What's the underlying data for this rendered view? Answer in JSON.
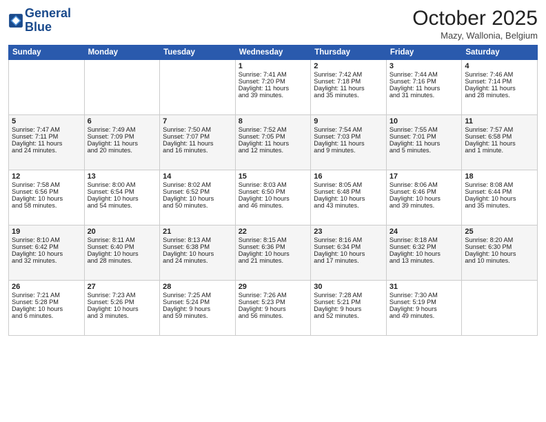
{
  "header": {
    "logo_line1": "General",
    "logo_line2": "Blue",
    "month": "October 2025",
    "location": "Mazy, Wallonia, Belgium"
  },
  "weekdays": [
    "Sunday",
    "Monday",
    "Tuesday",
    "Wednesday",
    "Thursday",
    "Friday",
    "Saturday"
  ],
  "weeks": [
    [
      {
        "day": "",
        "info": ""
      },
      {
        "day": "",
        "info": ""
      },
      {
        "day": "",
        "info": ""
      },
      {
        "day": "1",
        "info": "Sunrise: 7:41 AM\nSunset: 7:20 PM\nDaylight: 11 hours\nand 39 minutes."
      },
      {
        "day": "2",
        "info": "Sunrise: 7:42 AM\nSunset: 7:18 PM\nDaylight: 11 hours\nand 35 minutes."
      },
      {
        "day": "3",
        "info": "Sunrise: 7:44 AM\nSunset: 7:16 PM\nDaylight: 11 hours\nand 31 minutes."
      },
      {
        "day": "4",
        "info": "Sunrise: 7:46 AM\nSunset: 7:14 PM\nDaylight: 11 hours\nand 28 minutes."
      }
    ],
    [
      {
        "day": "5",
        "info": "Sunrise: 7:47 AM\nSunset: 7:11 PM\nDaylight: 11 hours\nand 24 minutes."
      },
      {
        "day": "6",
        "info": "Sunrise: 7:49 AM\nSunset: 7:09 PM\nDaylight: 11 hours\nand 20 minutes."
      },
      {
        "day": "7",
        "info": "Sunrise: 7:50 AM\nSunset: 7:07 PM\nDaylight: 11 hours\nand 16 minutes."
      },
      {
        "day": "8",
        "info": "Sunrise: 7:52 AM\nSunset: 7:05 PM\nDaylight: 11 hours\nand 12 minutes."
      },
      {
        "day": "9",
        "info": "Sunrise: 7:54 AM\nSunset: 7:03 PM\nDaylight: 11 hours\nand 9 minutes."
      },
      {
        "day": "10",
        "info": "Sunrise: 7:55 AM\nSunset: 7:01 PM\nDaylight: 11 hours\nand 5 minutes."
      },
      {
        "day": "11",
        "info": "Sunrise: 7:57 AM\nSunset: 6:58 PM\nDaylight: 11 hours\nand 1 minute."
      }
    ],
    [
      {
        "day": "12",
        "info": "Sunrise: 7:58 AM\nSunset: 6:56 PM\nDaylight: 10 hours\nand 58 minutes."
      },
      {
        "day": "13",
        "info": "Sunrise: 8:00 AM\nSunset: 6:54 PM\nDaylight: 10 hours\nand 54 minutes."
      },
      {
        "day": "14",
        "info": "Sunrise: 8:02 AM\nSunset: 6:52 PM\nDaylight: 10 hours\nand 50 minutes."
      },
      {
        "day": "15",
        "info": "Sunrise: 8:03 AM\nSunset: 6:50 PM\nDaylight: 10 hours\nand 46 minutes."
      },
      {
        "day": "16",
        "info": "Sunrise: 8:05 AM\nSunset: 6:48 PM\nDaylight: 10 hours\nand 43 minutes."
      },
      {
        "day": "17",
        "info": "Sunrise: 8:06 AM\nSunset: 6:46 PM\nDaylight: 10 hours\nand 39 minutes."
      },
      {
        "day": "18",
        "info": "Sunrise: 8:08 AM\nSunset: 6:44 PM\nDaylight: 10 hours\nand 35 minutes."
      }
    ],
    [
      {
        "day": "19",
        "info": "Sunrise: 8:10 AM\nSunset: 6:42 PM\nDaylight: 10 hours\nand 32 minutes."
      },
      {
        "day": "20",
        "info": "Sunrise: 8:11 AM\nSunset: 6:40 PM\nDaylight: 10 hours\nand 28 minutes."
      },
      {
        "day": "21",
        "info": "Sunrise: 8:13 AM\nSunset: 6:38 PM\nDaylight: 10 hours\nand 24 minutes."
      },
      {
        "day": "22",
        "info": "Sunrise: 8:15 AM\nSunset: 6:36 PM\nDaylight: 10 hours\nand 21 minutes."
      },
      {
        "day": "23",
        "info": "Sunrise: 8:16 AM\nSunset: 6:34 PM\nDaylight: 10 hours\nand 17 minutes."
      },
      {
        "day": "24",
        "info": "Sunrise: 8:18 AM\nSunset: 6:32 PM\nDaylight: 10 hours\nand 13 minutes."
      },
      {
        "day": "25",
        "info": "Sunrise: 8:20 AM\nSunset: 6:30 PM\nDaylight: 10 hours\nand 10 minutes."
      }
    ],
    [
      {
        "day": "26",
        "info": "Sunrise: 7:21 AM\nSunset: 5:28 PM\nDaylight: 10 hours\nand 6 minutes."
      },
      {
        "day": "27",
        "info": "Sunrise: 7:23 AM\nSunset: 5:26 PM\nDaylight: 10 hours\nand 3 minutes."
      },
      {
        "day": "28",
        "info": "Sunrise: 7:25 AM\nSunset: 5:24 PM\nDaylight: 9 hours\nand 59 minutes."
      },
      {
        "day": "29",
        "info": "Sunrise: 7:26 AM\nSunset: 5:23 PM\nDaylight: 9 hours\nand 56 minutes."
      },
      {
        "day": "30",
        "info": "Sunrise: 7:28 AM\nSunset: 5:21 PM\nDaylight: 9 hours\nand 52 minutes."
      },
      {
        "day": "31",
        "info": "Sunrise: 7:30 AM\nSunset: 5:19 PM\nDaylight: 9 hours\nand 49 minutes."
      },
      {
        "day": "",
        "info": ""
      }
    ]
  ]
}
